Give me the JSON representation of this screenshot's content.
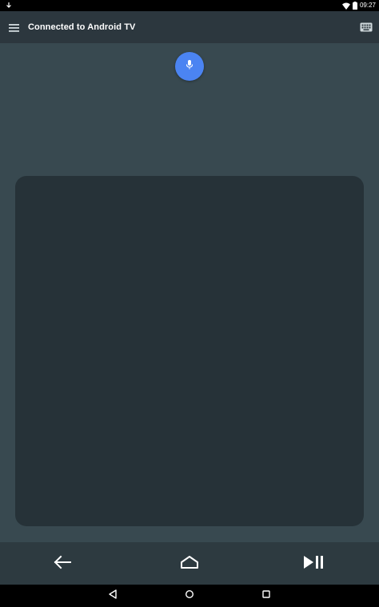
{
  "status_bar": {
    "time": "09:27",
    "left_icon": "download-icon",
    "right_icons": [
      "wifi-icon",
      "battery-icon"
    ]
  },
  "toolbar": {
    "menu_icon": "menu-icon",
    "title": "Connected to Android TV",
    "keyboard_icon": "keyboard-icon"
  },
  "mic": {
    "icon": "mic-icon",
    "color": "#4b84f2"
  },
  "touchpad": {
    "color": "#263238"
  },
  "controls": [
    {
      "name": "back",
      "icon": "arrow-back-icon"
    },
    {
      "name": "home",
      "icon": "home-icon"
    },
    {
      "name": "play-pause",
      "icon": "play-pause-icon"
    }
  ],
  "nav_bar": {
    "icons": [
      "nav-back-icon",
      "nav-home-icon",
      "nav-recents-icon"
    ]
  },
  "colors": {
    "background": "#384950",
    "toolbar": "#2c373e",
    "bottom_bar": "#2d3a40"
  }
}
